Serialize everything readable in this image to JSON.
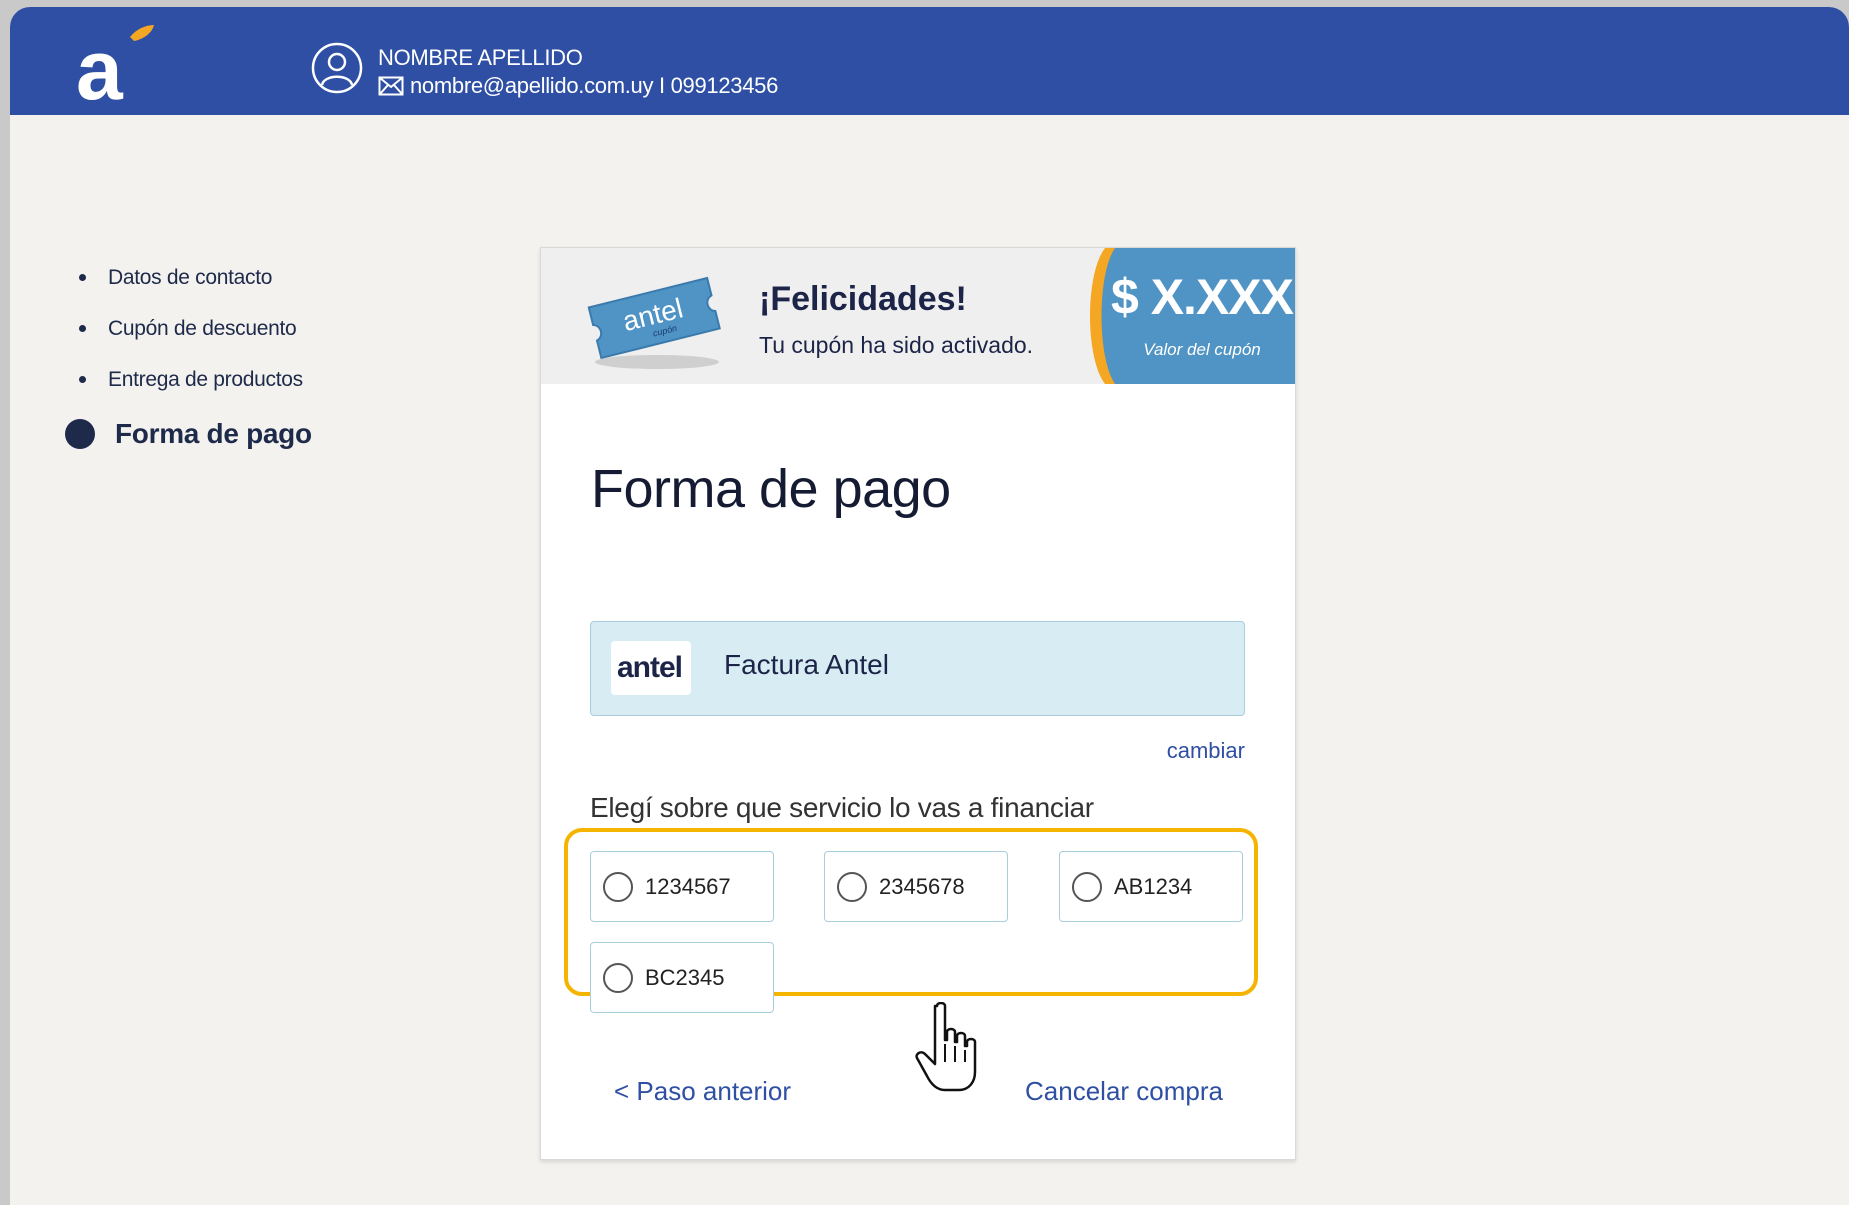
{
  "header": {
    "user_name": "NOMBRE APELLIDO",
    "user_contact": "nombre@apellido.com.uy I 099123456"
  },
  "steps": [
    {
      "label": "Datos de contacto"
    },
    {
      "label": "Cupón de descuento"
    },
    {
      "label": "Entrega de productos"
    },
    {
      "label": "Forma de pago",
      "active": true
    }
  ],
  "banner": {
    "ticket_brand": "antel",
    "ticket_sub": "cupón",
    "title": "¡Felicidades!",
    "subtitle": "Tu cupón ha sido activado.",
    "amount": "$ X.XXX",
    "amount_label": "Valor del cupón"
  },
  "main": {
    "title": "Forma de pago",
    "method_logo": "antel",
    "method_label": "Factura Antel",
    "change_link": "cambiar",
    "choose_label": "Elegí sobre que servicio lo vas a financiar",
    "options": [
      "1234567",
      "2345678",
      "AB1234",
      "BC2345"
    ],
    "prev_link": "< Paso anterior",
    "cancel_link": "Cancelar compra"
  },
  "colors": {
    "topbar": "#2e4fa3",
    "accent_orange": "#f5a623",
    "highlight": "#f5b400",
    "coupon_blue": "#4f94c4"
  },
  "icons": [
    "antel-logo-icon",
    "user-icon",
    "mail-icon",
    "ticket-icon",
    "hand-cursor-icon"
  ]
}
